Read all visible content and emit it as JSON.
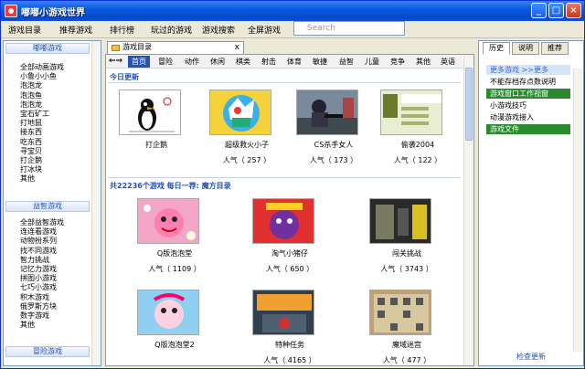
{
  "window": {
    "title": "嘟嘟小游戏世界"
  },
  "menu": [
    "游戏目录",
    "推荐游戏",
    "排行榜",
    "玩过的游戏",
    "游戏搜索",
    "全屏游戏"
  ],
  "search": {
    "placeholder": "Search"
  },
  "left": {
    "section1": "嘟嘟游戏",
    "items1": [
      "全部动画游戏",
      "小鲁小小鱼",
      "泡泡龙",
      "泡泡鱼",
      "泡泡龙",
      "宝石矿工",
      "打地鼠",
      "接东西",
      "吃东西",
      "寻宝贝",
      "打企鹅",
      "打冰块",
      "其他"
    ],
    "section2": "益智游戏",
    "items2": [
      "全部益智游戏",
      "连连看游戏",
      "动物扮系列",
      "找不同游戏",
      "智力挑战",
      "记忆力游戏",
      "拼图小游戏",
      "七巧小游戏",
      "积木游戏",
      "俄罗斯方块",
      "数字游戏",
      "其他"
    ],
    "section3": "冒险游戏"
  },
  "tab": {
    "label": "游戏目录",
    "close": "x"
  },
  "categories": [
    "首页",
    "冒险",
    "动作",
    "休闲",
    "棋类",
    "射击",
    "体育",
    "敏捷",
    "益智",
    "儿童",
    "竞争",
    "其他",
    "英语"
  ],
  "today": {
    "title": "今日更新",
    "games": [
      {
        "name": "打企鹅",
        "pop": ""
      },
      {
        "name": "超级救火小子",
        "pop": "人气（ 257 ）"
      },
      {
        "name": "CS杀手女人",
        "pop": "人气（ 173 ）"
      },
      {
        "name": "偷袭2004",
        "pop": "人气（ 122 ）"
      }
    ]
  },
  "all": {
    "title": "共22236个游戏   每日一荐: 魔方目录",
    "games": [
      {
        "name": "Q版泡泡堂",
        "pop": "人气（ 1109 ）"
      },
      {
        "name": "淘气小猪仔",
        "pop": "人气（ 650 ）"
      },
      {
        "name": "闯关挑战",
        "pop": "人气（ 3743 ）"
      },
      {
        "name": "Q版泡泡堂2",
        "pop": ""
      },
      {
        "name": "特种任务",
        "pop": "人气（ 4165 ）"
      },
      {
        "name": "魔域迷宫",
        "pop": "人气（ 477 ）"
      }
    ]
  },
  "right": {
    "tabs": [
      "历史",
      "说明",
      "推荐"
    ],
    "items": [
      "更多游戏 >>更多",
      "不能存档存点数说明",
      "游戏窗口工作视窗",
      "小游戏技巧",
      "动漫游戏接入",
      "游戏文件"
    ],
    "footer": "检查更新"
  },
  "colors": {
    "accent": "#2453b8",
    "highlight": "#2b8a2f",
    "titlebar": "#0a5ae4"
  }
}
